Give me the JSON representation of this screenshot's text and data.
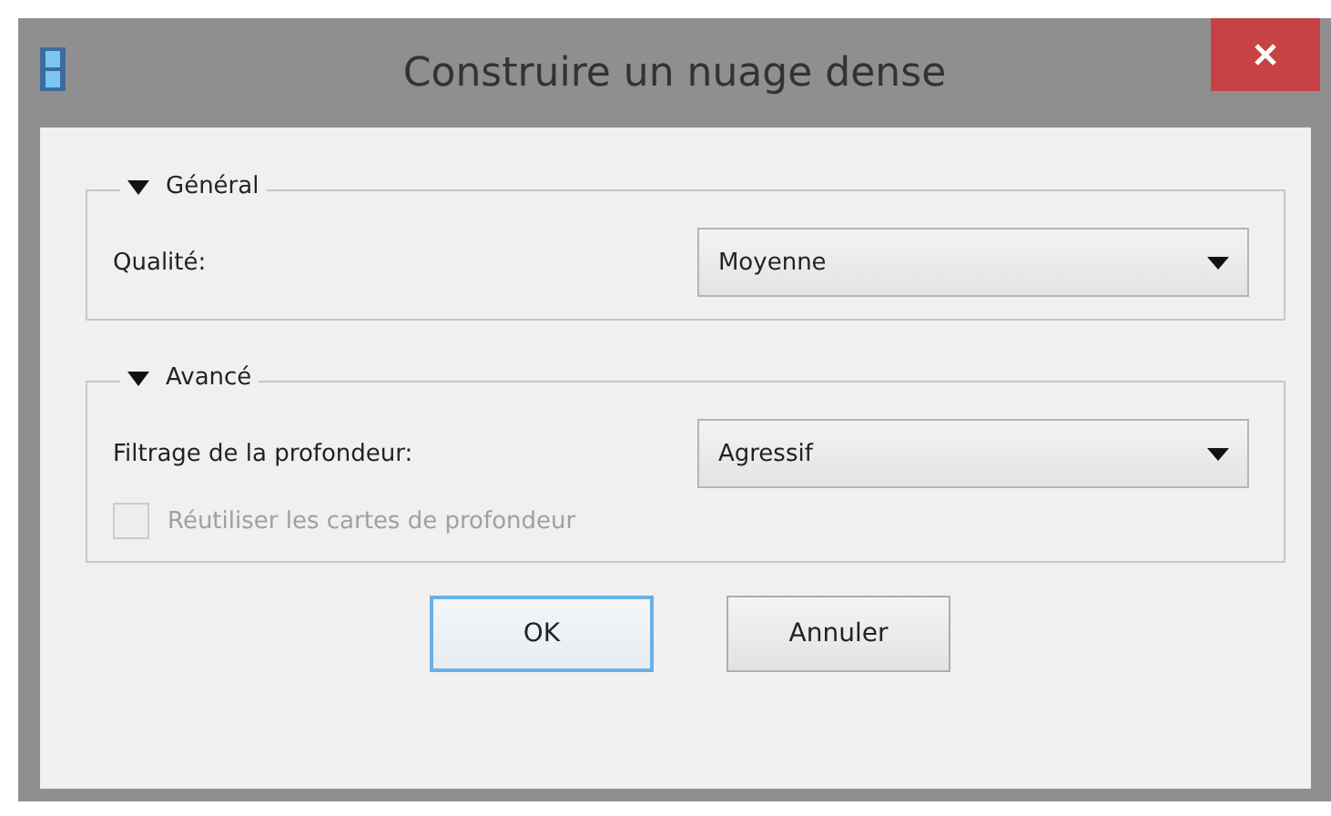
{
  "window": {
    "title": "Construire un nuage dense"
  },
  "groups": [
    {
      "title": "Général",
      "expanded": true,
      "rows": [
        {
          "kind": "combo",
          "label": "Qualité:",
          "value": "Moyenne"
        }
      ]
    },
    {
      "title": "Avancé",
      "expanded": true,
      "rows": [
        {
          "kind": "combo",
          "label": "Filtrage de la profondeur:",
          "value": "Agressif"
        },
        {
          "kind": "checkbox",
          "label": "Réutiliser les cartes de profondeur",
          "checked": false,
          "disabled": true
        }
      ]
    }
  ],
  "buttons": [
    {
      "label": "OK",
      "default": true
    },
    {
      "label": "Annuler",
      "default": false
    }
  ]
}
